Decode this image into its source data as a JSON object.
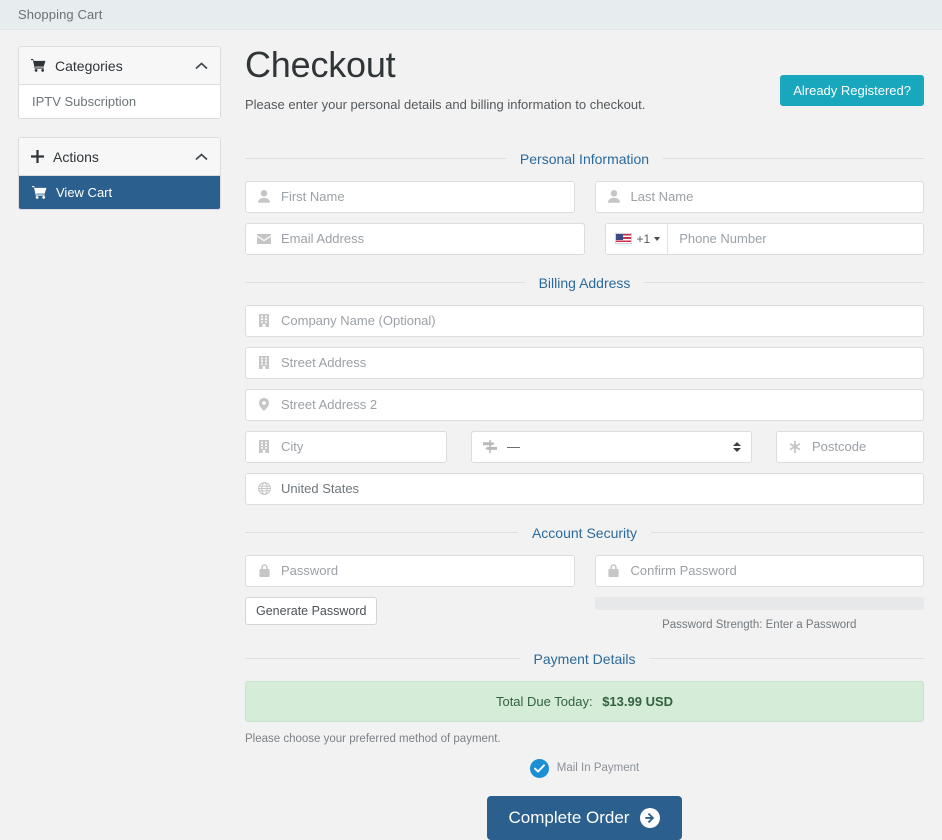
{
  "topbar": {
    "title": "Shopping Cart"
  },
  "sidebar": {
    "panels": [
      {
        "title": "Categories",
        "icon": "cart-icon",
        "collapse_icon": "chevron-up-icon",
        "items": [
          {
            "label": "IPTV Subscription",
            "active": false
          }
        ]
      },
      {
        "title": "Actions",
        "icon": "plus-icon",
        "collapse_icon": "chevron-up-icon",
        "items": [
          {
            "label": "View Cart",
            "active": true
          }
        ]
      }
    ]
  },
  "main": {
    "title": "Checkout",
    "subtitle": "Please enter your personal details and billing information to checkout.",
    "already_registered_label": "Already Registered?",
    "sections": {
      "personal": "Personal Information",
      "billing": "Billing Address",
      "security": "Account Security",
      "payment": "Payment Details"
    },
    "fields": {
      "first_name": {
        "placeholder": "First Name",
        "value": "",
        "icon": "user-icon"
      },
      "last_name": {
        "placeholder": "Last Name",
        "value": "",
        "icon": "user-icon"
      },
      "email": {
        "placeholder": "Email Address",
        "value": "",
        "icon": "envelope-icon"
      },
      "phone": {
        "placeholder": "Phone Number",
        "value": "",
        "dial_code": "+1",
        "flag": "us-flag-icon"
      },
      "company": {
        "placeholder": "Company Name (Optional)",
        "value": "",
        "icon": "building-icon"
      },
      "street1": {
        "placeholder": "Street Address",
        "value": "",
        "icon": "building-icon"
      },
      "street2": {
        "placeholder": "Street Address 2",
        "value": "",
        "icon": "map-marker-icon"
      },
      "city": {
        "placeholder": "City",
        "value": "",
        "icon": "building-icon"
      },
      "state": {
        "value": "—",
        "icon": "map-signs-icon"
      },
      "postcode": {
        "placeholder": "Postcode",
        "value": "",
        "icon": "asterisk-icon"
      },
      "country": {
        "value": "United States",
        "icon": "globe-icon"
      },
      "password": {
        "placeholder": "Password",
        "value": "",
        "icon": "lock-icon"
      },
      "confirm_password": {
        "placeholder": "Confirm Password",
        "value": "",
        "icon": "lock-icon"
      }
    },
    "security": {
      "generate_label": "Generate Password",
      "strength_text": "Password Strength: Enter a Password",
      "strength_percent": 0
    },
    "payment": {
      "total_label": "Total Due Today:",
      "total_amount": "$13.99 USD",
      "note": "Please choose your preferred method of payment.",
      "methods": [
        {
          "label": "Mail In Payment",
          "selected": true
        }
      ],
      "complete_label": "Complete Order",
      "complete_icon": "arrow-circle-right-icon"
    }
  },
  "colors": {
    "accent_teal": "#19a7bd",
    "accent_blue": "#2b5f8e",
    "radio_blue": "#1b8fd3",
    "total_bg": "#d5ecd9",
    "legend_text": "#2c6a9b",
    "page_bg": "#f2f2f2",
    "topbar_bg": "#e7ecef"
  }
}
